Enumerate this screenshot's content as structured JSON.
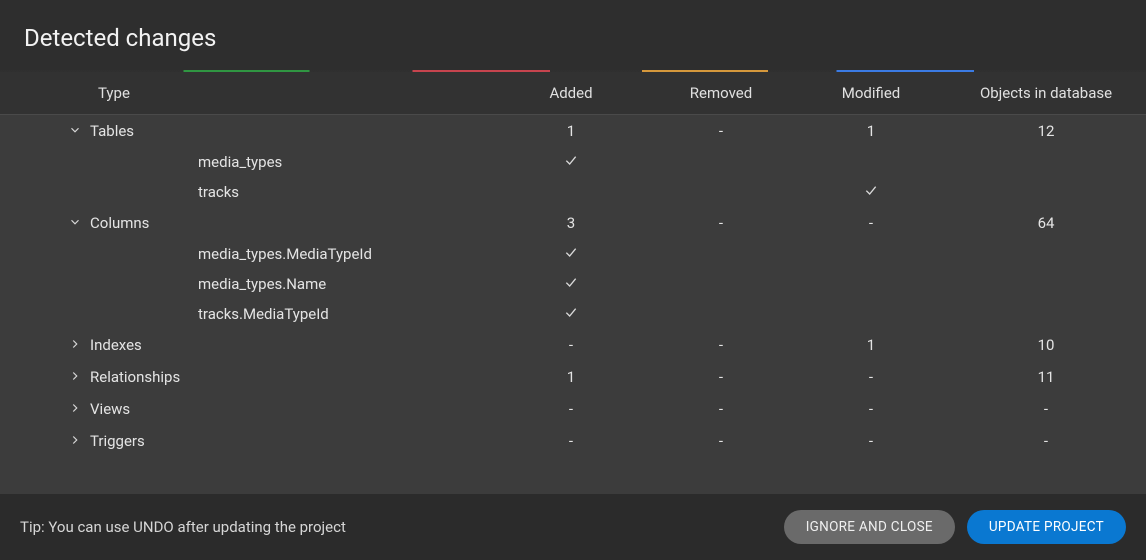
{
  "title": "Detected changes",
  "columns": {
    "type": "Type",
    "added": "Added",
    "removed": "Removed",
    "modified": "Modified",
    "db": "Objects in database"
  },
  "rows": {
    "tables": {
      "label": "Tables",
      "expanded": true,
      "added": "1",
      "removed": "-",
      "modified": "1",
      "db": "12"
    },
    "media_types": {
      "label": "media_types"
    },
    "tracks": {
      "label": "tracks"
    },
    "columns": {
      "label": "Columns",
      "expanded": true,
      "added": "3",
      "removed": "-",
      "modified": "-",
      "db": "64"
    },
    "col_mt_mtid": {
      "label": "media_types.MediaTypeId"
    },
    "col_mt_name": {
      "label": "media_types.Name"
    },
    "col_tr_mtid": {
      "label": "tracks.MediaTypeId"
    },
    "indexes": {
      "label": "Indexes",
      "expanded": false,
      "added": "-",
      "removed": "-",
      "modified": "1",
      "db": "10"
    },
    "relationships": {
      "label": "Relationships",
      "expanded": false,
      "added": "1",
      "removed": "-",
      "modified": "-",
      "db": "11"
    },
    "views": {
      "label": "Views",
      "expanded": false,
      "added": "-",
      "removed": "-",
      "modified": "-",
      "db": "-"
    },
    "triggers": {
      "label": "Triggers",
      "expanded": false,
      "added": "-",
      "removed": "-",
      "modified": "-",
      "db": "-"
    }
  },
  "footer": {
    "tip": "Tip: You can use UNDO after updating the project",
    "ignore": "IGNORE AND CLOSE",
    "update": "UPDATE PROJECT"
  }
}
